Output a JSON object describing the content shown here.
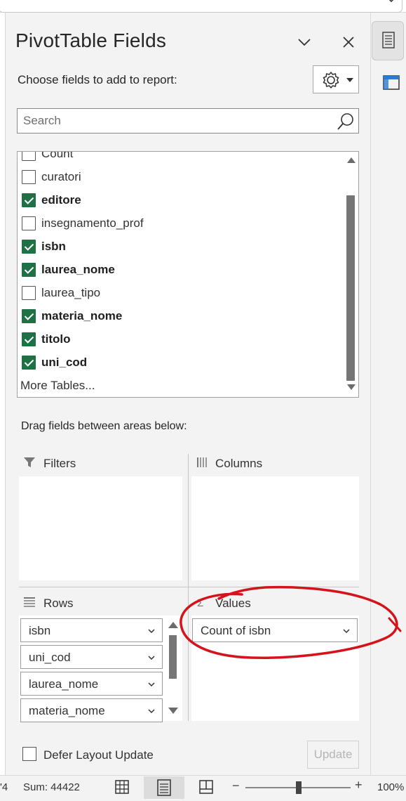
{
  "pane": {
    "title": "PivotTable Fields",
    "choose_label": "Choose fields to add to report:",
    "search_placeholder": "Search"
  },
  "fields": [
    {
      "label": "Count",
      "checked": false,
      "partial": true
    },
    {
      "label": "curatori",
      "checked": false
    },
    {
      "label": "editore",
      "checked": true
    },
    {
      "label": "insegnamento_prof",
      "checked": false
    },
    {
      "label": "isbn",
      "checked": true
    },
    {
      "label": "laurea_nome",
      "checked": true
    },
    {
      "label": "laurea_tipo",
      "checked": false
    },
    {
      "label": "materia_nome",
      "checked": true
    },
    {
      "label": "titolo",
      "checked": true
    },
    {
      "label": "uni_cod",
      "checked": true
    }
  ],
  "more_tables": "More Tables...",
  "areas": {
    "drag_label": "Drag fields between areas below:",
    "filters": "Filters",
    "columns": "Columns",
    "rows": "Rows",
    "values": "Values",
    "row_items": [
      "isbn",
      "uni_cod",
      "laurea_nome",
      "materia_nome"
    ],
    "value_items": [
      "Count of isbn"
    ]
  },
  "defer_layout_update": "Defer Layout Update",
  "update_button": "Update",
  "status": {
    "prefix": "'4",
    "sum": "Sum: 44422",
    "zoom": "100%"
  },
  "colors": {
    "check_green": "#1e7145",
    "annotation_red": "#d4141a"
  }
}
